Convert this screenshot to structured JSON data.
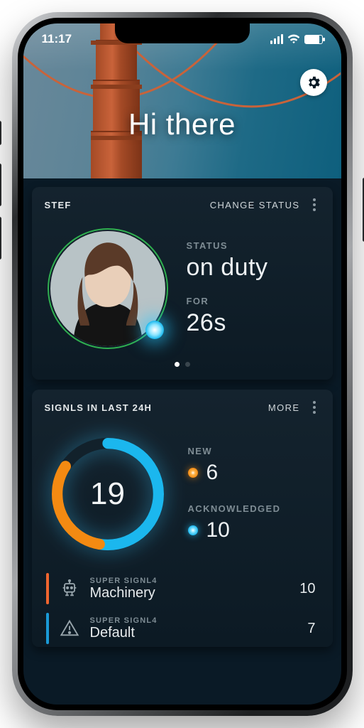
{
  "status_bar": {
    "time": "11:17"
  },
  "hero": {
    "greeting": "Hi there"
  },
  "user_card": {
    "name": "STEF",
    "change_label": "CHANGE STATUS",
    "status_label": "STATUS",
    "status_value": "on duty",
    "for_label": "FOR",
    "for_value": "26s",
    "ring_color": "#2fae4f"
  },
  "signals_card": {
    "title": "SIGNLS IN LAST 24H",
    "more_label": "MORE",
    "total": "19",
    "new_label": "NEW",
    "new_value": "6",
    "ack_label": "ACKNOWLEDGED",
    "ack_value": "10",
    "colors": {
      "new": "#f38a12",
      "ack": "#1bb7ee"
    },
    "categories": [
      {
        "group": "SUPER SIGNL4",
        "name": "Machinery",
        "count": "10",
        "bar": "#f0652f",
        "icon": "robot"
      },
      {
        "group": "SUPER SIGNL4",
        "name": "Default",
        "count": "7",
        "bar": "#1a9ad6",
        "icon": "warning"
      }
    ]
  }
}
